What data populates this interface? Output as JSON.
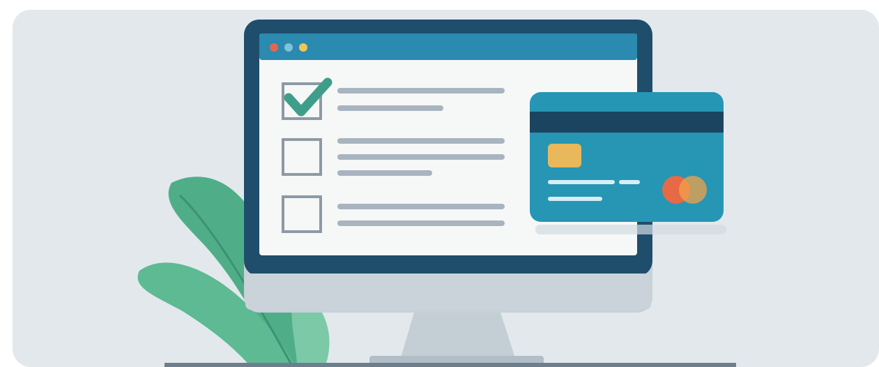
{
  "illustration": {
    "subject": "monitor-with-checklist-and-credit-card",
    "icons": [
      "check-icon",
      "credit-card-icon",
      "plant-icon",
      "window-dot-icon"
    ],
    "checklist": {
      "items": [
        {
          "checked": true
        },
        {
          "checked": false
        },
        {
          "checked": false
        }
      ]
    },
    "colors": {
      "background": "#e3e8ec",
      "monitor_frame": "#1f4e6c",
      "screen": "#f6f7f7",
      "titlebar": "#2a8ab0",
      "check": "#3f9e89",
      "text_lines": "#a8b4bf",
      "card": "#2696b4",
      "card_stripe": "#1b4460",
      "card_chip": "#e8b85a",
      "card_logo": "#e0724a",
      "plant": "#4fae88",
      "stand": "#b9c5cd"
    }
  }
}
